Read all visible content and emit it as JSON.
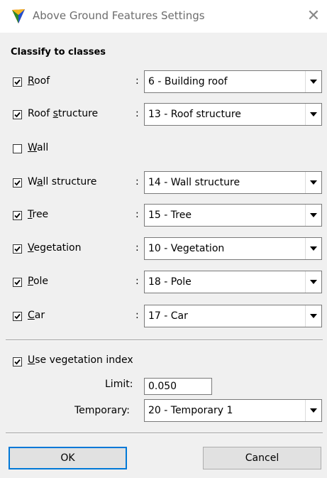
{
  "window": {
    "title": "Above Ground Features Settings",
    "close_glyph": "✕"
  },
  "section_title": "Classify to classes",
  "classes": [
    {
      "pre": "",
      "key": "R",
      "post": "oof",
      "checked": true,
      "value": "6 - Building roof"
    },
    {
      "pre": "Roof ",
      "key": "s",
      "post": "tructure",
      "checked": true,
      "value": "13 - Roof structure"
    },
    {
      "pre": "",
      "key": "W",
      "post": "all",
      "checked": false,
      "value": ""
    },
    {
      "pre": "W",
      "key": "a",
      "post": "ll structure",
      "checked": true,
      "value": "14 - Wall structure"
    },
    {
      "pre": "",
      "key": "T",
      "post": "ree",
      "checked": true,
      "value": "15 - Tree"
    },
    {
      "pre": "",
      "key": "V",
      "post": "egetation",
      "checked": true,
      "value": "10 - Vegetation"
    },
    {
      "pre": "",
      "key": "P",
      "post": "ole",
      "checked": true,
      "value": "18 - Pole"
    },
    {
      "pre": "",
      "key": "C",
      "post": "ar",
      "checked": true,
      "value": "17 - Car"
    }
  ],
  "colon": ":",
  "vegetation_index": {
    "key": "U",
    "post": "se vegetation index",
    "checked": true,
    "limit_label": "Limit:",
    "limit_value": "0.050",
    "temporary_label": "Temporary:",
    "temporary_value": "20 - Temporary 1"
  },
  "buttons": {
    "ok": "OK",
    "cancel": "Cancel"
  },
  "colors": {
    "accent": "#0078d7",
    "background": "#f0f0f0"
  }
}
